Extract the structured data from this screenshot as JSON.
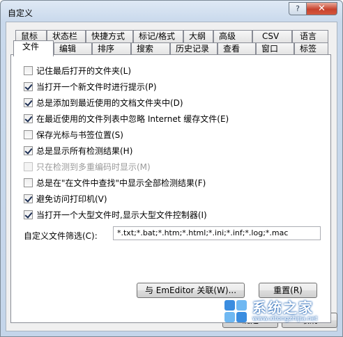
{
  "window": {
    "title": "自定义",
    "help_label": "?",
    "close_label": "✕"
  },
  "tabs_row1": [
    "鼠标",
    "状态栏",
    "快捷方式",
    "标记/格式",
    "大纲",
    "高级",
    "CSV",
    "语言"
  ],
  "tabs_row2": [
    "文件",
    "编辑",
    "排序",
    "搜索",
    "历史记录",
    "查看",
    "窗口",
    "标签"
  ],
  "active_tab": "文件",
  "options": [
    {
      "label": "记住最后打开的文件夹(L)",
      "checked": false,
      "enabled": true
    },
    {
      "label": "当打开一个新文件时进行提示(P)",
      "checked": true,
      "enabled": true
    },
    {
      "label": "总是添加到最近使用的文档文件夹中(D)",
      "checked": true,
      "enabled": true
    },
    {
      "label": "在最近使用的文件列表中忽略 Internet 缓存文件(E)",
      "checked": true,
      "enabled": true
    },
    {
      "label": "保存光标与书签位置(S)",
      "checked": false,
      "enabled": true
    },
    {
      "label": "总是显示所有检测结果(H)",
      "checked": true,
      "enabled": true
    },
    {
      "label": "只在检测到多重编码时显示(M)",
      "checked": false,
      "enabled": false
    },
    {
      "label": "总是在\"在文件中查找\"中显示全部检测结果(F)",
      "checked": false,
      "enabled": true
    },
    {
      "label": "避免访问打印机(V)",
      "checked": true,
      "enabled": true
    },
    {
      "label": "当打开一个大型文件时,显示大型文件控制器(I)",
      "checked": true,
      "enabled": true
    }
  ],
  "filter": {
    "label": "自定义文件筛选(C):",
    "value": "*.txt;*.bat;*.htm;*.html;*.ini;*.inf;*.log;*.mac"
  },
  "buttons": {
    "associate": "与 EmEditor 关联(W)...",
    "reset": "重置(R)",
    "ok": "确定",
    "cancel": "取消"
  },
  "watermark": {
    "text": "系统之家",
    "subtext": "www.xitongzhijia.net"
  }
}
